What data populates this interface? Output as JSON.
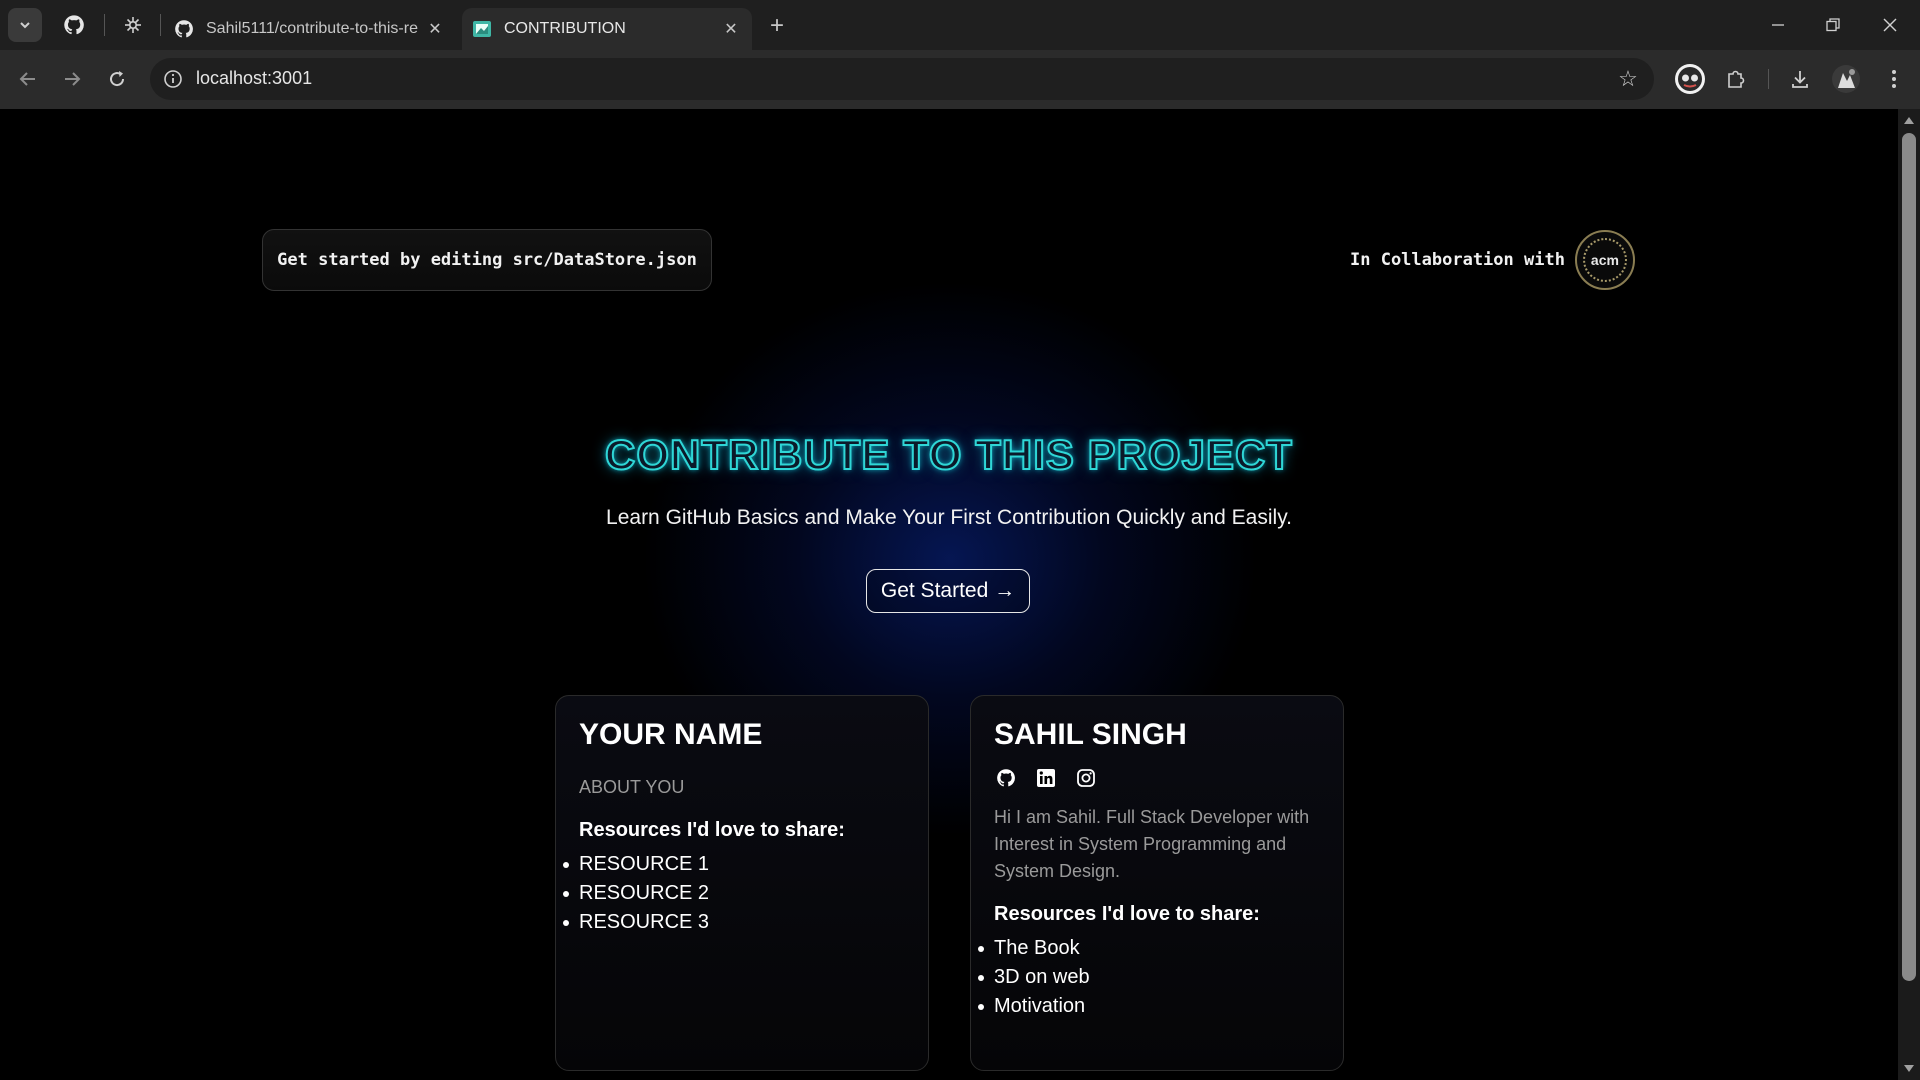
{
  "browser": {
    "tabs": [
      {
        "title": "Sahil5111/contribute-to-this-re",
        "icon": "github-icon",
        "active": false
      },
      {
        "title": "CONTRIBUTION",
        "icon": "site-favicon",
        "active": true
      }
    ],
    "url": "localhost:3001"
  },
  "page": {
    "hint_prefix": "Get started by editing ",
    "hint_file": "src/DataStore.json",
    "collab_text": "In Collaboration with",
    "collab_logo_text": "acm",
    "title": "CONTRIBUTE TO THIS PROJECT",
    "subtitle": "Learn GitHub Basics and Make Your First Contribution Quickly and Easily.",
    "cta": "Get Started →"
  },
  "cards": [
    {
      "name": "YOUR NAME",
      "about": "ABOUT YOU",
      "resources_heading": "Resources I'd love to share:",
      "resources": [
        "RESOURCE 1",
        "RESOURCE 2",
        "RESOURCE 3"
      ]
    },
    {
      "name": "SAHIL SINGH",
      "socials": [
        "github-icon",
        "linkedin-icon",
        "instagram-icon"
      ],
      "about": "Hi I am Sahil. Full Stack Developer with Interest in System Programming and System Design.",
      "resources_heading": "Resources I'd love to share:",
      "resources": [
        "The Book",
        "3D on web",
        "Motivation"
      ]
    }
  ],
  "colors": {
    "title_stroke": "#2fd6d6",
    "glow": "#0a2896",
    "background": "#000000"
  }
}
